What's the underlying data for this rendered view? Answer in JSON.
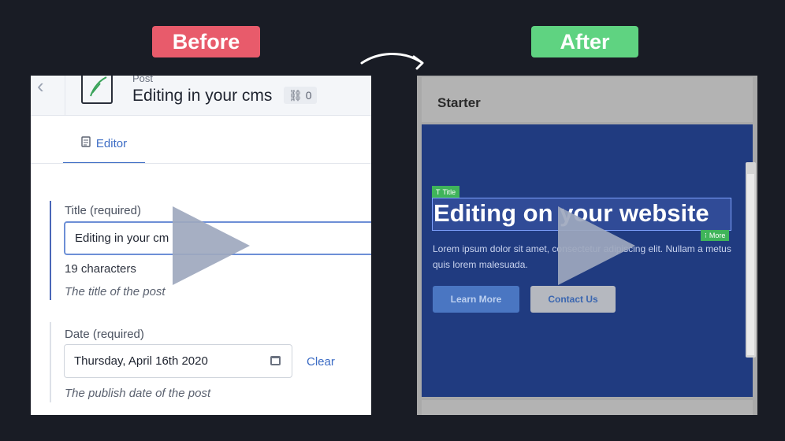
{
  "labels": {
    "before": "Before",
    "after": "After"
  },
  "before": {
    "header_kind": "Post",
    "header_title": "Editing in your cms",
    "link_count": "0",
    "tab_label": "Editor",
    "title_field_label": "Title (required)",
    "title_value": "Editing in your cm",
    "char_count": "19 characters",
    "title_help": "The title of the post",
    "date_field_label": "Date (required)",
    "date_value": "Thursday, April 16th 2020",
    "clear_label": "Clear",
    "date_help": "The publish date of the post"
  },
  "after": {
    "brand": "Starter",
    "title_tag": "Title",
    "hero_title": "Editing on your website",
    "more_tag": "More",
    "body": "Lorem ipsum dolor sit amet, consectetur adipiscing elit. Nullam a metus quis lorem malesuada.",
    "learn_label": "Learn More",
    "contact_label": "Contact Us"
  },
  "colors": {
    "before_pill": "#e85b6b",
    "after_pill": "#5fd381",
    "hero_bg": "#203b80",
    "accent": "#3b6bc4"
  },
  "icons": [
    "arrow-icon",
    "back-chevron-icon",
    "feather-icon",
    "link-icon",
    "document-icon",
    "calendar-icon",
    "title-tag-icon",
    "more-tag-icon",
    "play-icon"
  ]
}
